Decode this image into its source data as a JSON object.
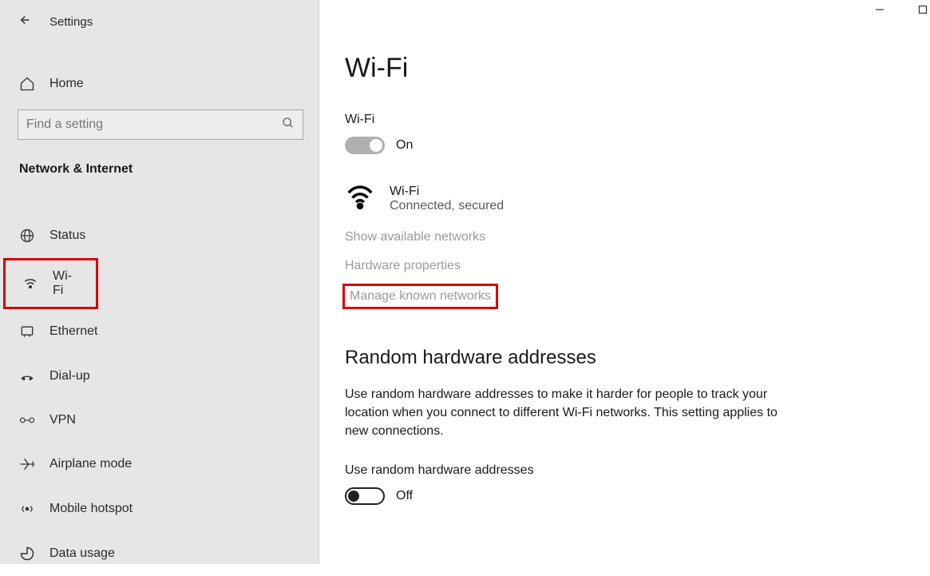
{
  "header": {
    "title": "Settings"
  },
  "sidebar": {
    "home_label": "Home",
    "search_placeholder": "Find a setting",
    "category": "Network & Internet",
    "items": [
      {
        "label": "Status",
        "icon": "globe-icon"
      },
      {
        "label": "Wi-Fi",
        "icon": "wifi-icon"
      },
      {
        "label": "Ethernet",
        "icon": "ethernet-icon"
      },
      {
        "label": "Dial-up",
        "icon": "dialup-icon"
      },
      {
        "label": "VPN",
        "icon": "vpn-icon"
      },
      {
        "label": "Airplane mode",
        "icon": "airplane-icon"
      },
      {
        "label": "Mobile hotspot",
        "icon": "hotspot-icon"
      },
      {
        "label": "Data usage",
        "icon": "data-icon"
      }
    ]
  },
  "main": {
    "title": "Wi-Fi",
    "wifi_label": "Wi-Fi",
    "wifi_toggle_state": "On",
    "connection": {
      "name": "Wi-Fi",
      "state": "Connected, secured"
    },
    "links": {
      "show_available": "Show available networks",
      "hardware_props": "Hardware properties",
      "manage_known": "Manage known networks"
    },
    "random_section": {
      "heading": "Random hardware addresses",
      "description": "Use random hardware addresses to make it harder for people to track your location when you connect to different Wi-Fi networks. This setting applies to new connections.",
      "toggle_label": "Use random hardware addresses",
      "toggle_state": "Off"
    }
  }
}
